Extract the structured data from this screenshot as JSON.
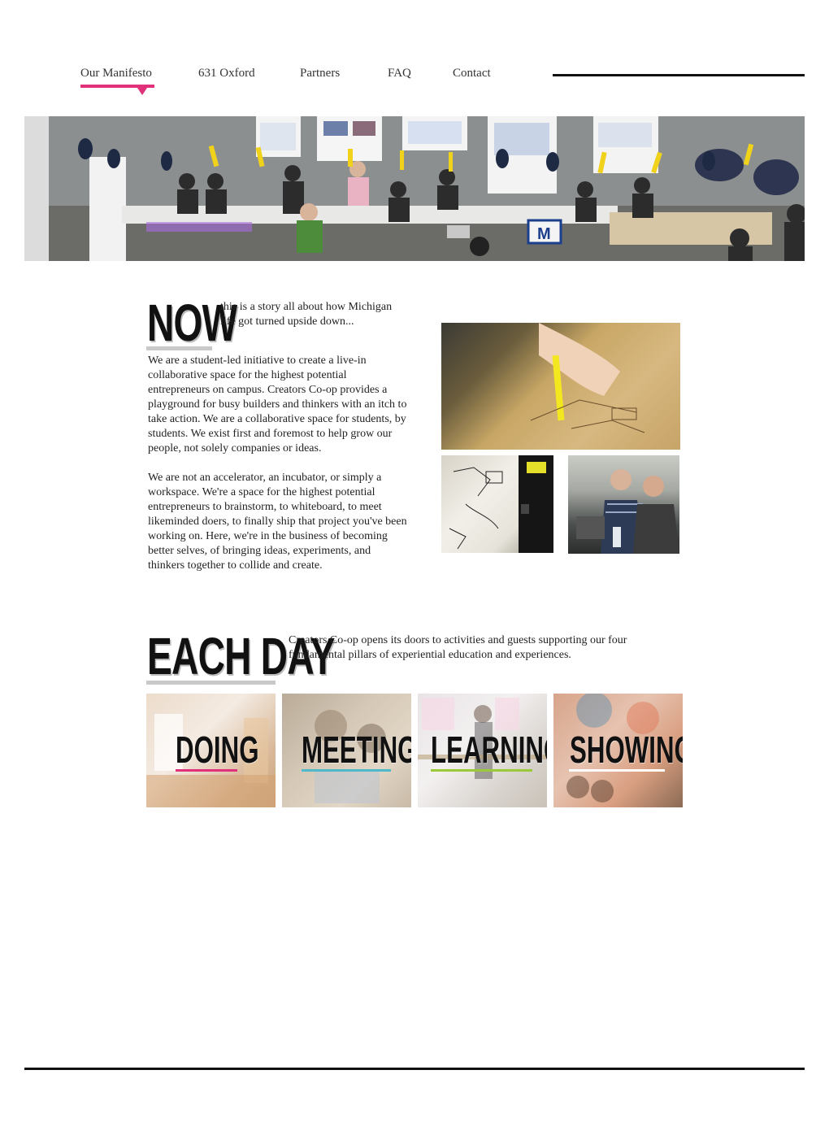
{
  "nav": {
    "items": [
      {
        "label": "Our Manifesto"
      },
      {
        "label": "631 Oxford"
      },
      {
        "label": "Partners"
      },
      {
        "label": "FAQ"
      },
      {
        "label": "Contact"
      }
    ],
    "active_color": "#e0317a"
  },
  "now_section": {
    "heading": "NOW",
    "intro": "this is a story all about how Michigan life got turned upside down...",
    "paragraph1": "We are a student-led initiative to create a live-in collaborative space for the highest potential entrepreneurs on campus.  Creators Co-op provides a playground for busy builders and thinkers with an itch to take action.  We are a collaborative space for students, by students.  We exist first and foremost to help grow our people, not solely companies or ideas.",
    "paragraph2": "We are not an accelerator, an incubator, or simply a workspace.  We're a space for the highest potential entrepreneurs to brainstorm, to whiteboard, to meet likeminded doers, to finally ship that project you've been working on.  Here, we're in the business of becoming better selves, of bringing ideas, experiments, and thinkers together to collide and create."
  },
  "each_day_section": {
    "heading": "EACH DAY",
    "intro": "Creators Co-op opens its doors to activities and guests supporting our four fundamental pillars of experiential education and experiences.",
    "pillars": [
      {
        "label": "DOING",
        "color": "#e0317a"
      },
      {
        "label": "MEETING",
        "color": "#4fb8c9"
      },
      {
        "label": "LEARNING",
        "color": "#9bc93a"
      },
      {
        "label": "SHOWING",
        "color": "#ffffff"
      }
    ]
  }
}
